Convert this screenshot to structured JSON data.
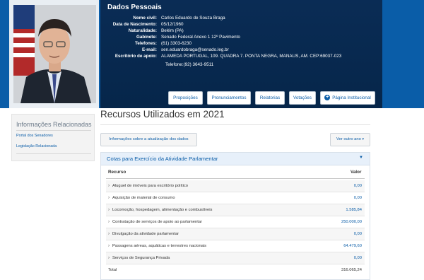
{
  "dados": {
    "title": "Dados Pessoais",
    "fields": [
      {
        "label": "Nome civil:",
        "value": "Carlos Eduardo de Souza Braga"
      },
      {
        "label": "Data de Nascimento:",
        "value": "05/12/1960"
      },
      {
        "label": "Naturalidade:",
        "value": "Belém (PA)"
      },
      {
        "label": "Gabinete:",
        "value": "Senado Federal Anexo 1 12º Pavimento"
      },
      {
        "label": "Telefones:",
        "value": "(61) 3303-6230"
      },
      {
        "label": "E-mail:",
        "value": "sen.eduardobraga@senado.leg.br"
      },
      {
        "label": "Escritório de apoio:",
        "value": "ALAMEDA PORTUGAL, 109. QUADRA 7. PONTA NEGRA, MANAUS, AM. CEP:69037-023"
      }
    ],
    "escritorio_telefone": "Telefone:(92) 3643-9511"
  },
  "header_buttons": [
    "Proposições",
    "Pronunciamentos",
    "Relatorias",
    "Votações",
    "Página Institucional"
  ],
  "side": {
    "title": "Informações Relacionadas",
    "links": [
      "Portal dos Senadores",
      "Legislação Relacionada"
    ]
  },
  "main": {
    "title": "Recursos Utilizados em 2021",
    "info_button": "Informações sobre a atualização dos dados",
    "year_button": "Ver outro ano",
    "panel_title": "Cotas para Exercício da Atividade Parlamentar",
    "col_recurso": "Recurso",
    "col_valor": "Valor",
    "rows": [
      {
        "label": "Aluguel de imóveis para escritório político",
        "value": "0,00"
      },
      {
        "label": "Aquisição de material de consumo",
        "value": "0,00"
      },
      {
        "label": "Locomoção, hospedagem, alimentação e combustíveis",
        "value": "1.585,84"
      },
      {
        "label": "Contratação de serviços de apoio ao parlamentar",
        "value": "250.000,00"
      },
      {
        "label": "Divulgação da atividade parlamentar",
        "value": "0,00"
      },
      {
        "label": "Passagens aéreas, aquáticas e terrestres nacionais",
        "value": "64.479,60"
      },
      {
        "label": "Serviços de Segurança Privada",
        "value": "0,00"
      }
    ],
    "total_label": "Total",
    "total_value": "316.065,24"
  }
}
